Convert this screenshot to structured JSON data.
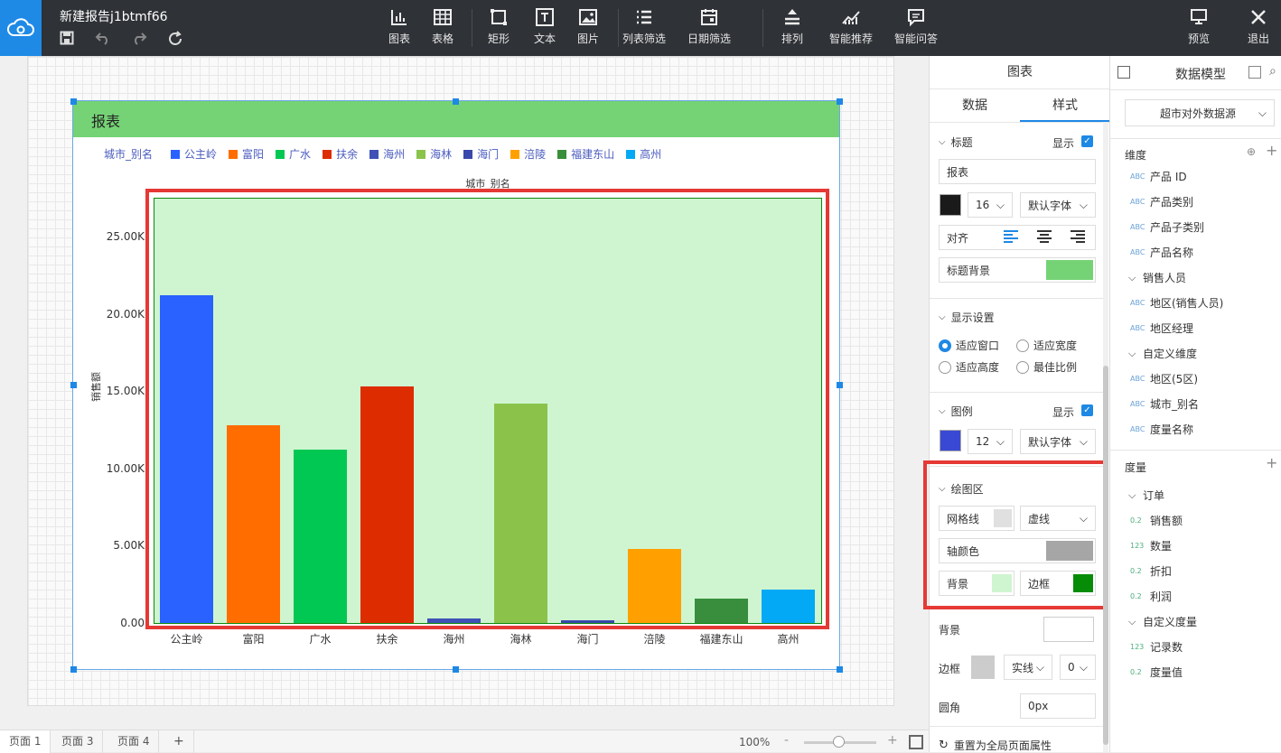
{
  "app": {
    "doc_title": "新建报告j1btmf66",
    "toolbar": [
      {
        "icon": "bar-chart-icon",
        "label": "图表"
      },
      {
        "icon": "table-icon",
        "label": "表格"
      },
      {
        "icon": "rectangle-icon",
        "label": "矩形"
      },
      {
        "icon": "text-icon",
        "label": "文本"
      },
      {
        "icon": "image-icon",
        "label": "图片"
      },
      {
        "icon": "list-filter-icon",
        "label": "列表筛选"
      },
      {
        "icon": "calendar-icon",
        "label": "日期筛选"
      },
      {
        "icon": "arrange-icon",
        "label": "排列"
      },
      {
        "icon": "smart-recommend-icon",
        "label": "智能推荐"
      },
      {
        "icon": "smart-qa-icon",
        "label": "智能问答"
      }
    ],
    "preview_label": "预览",
    "exit_label": "退出"
  },
  "report": {
    "title": "报表",
    "legend_field": "城市_别名",
    "legend_items": [
      {
        "label": "公主岭",
        "color": "#2962ff"
      },
      {
        "label": "富阳",
        "color": "#ff6d00"
      },
      {
        "label": "广水",
        "color": "#00c853"
      },
      {
        "label": "扶余",
        "color": "#dd2c00"
      },
      {
        "label": "海州",
        "color": "#3f51b5"
      },
      {
        "label": "海林",
        "color": "#8bc34a"
      },
      {
        "label": "海门",
        "color": "#3949ab"
      },
      {
        "label": "涪陵",
        "color": "#ffa000"
      },
      {
        "label": "福建东山",
        "color": "#388e3c"
      },
      {
        "label": "高州",
        "color": "#03a9f4"
      }
    ]
  },
  "chart_data": {
    "type": "bar",
    "title": "城市_别名",
    "xlabel": "",
    "ylabel": "销售额",
    "categories": [
      "公主岭",
      "富阳",
      "广水",
      "扶余",
      "海州",
      "海林",
      "海门",
      "涪陵",
      "福建东山",
      "高州"
    ],
    "values": [
      21200,
      12800,
      11200,
      15300,
      320,
      14200,
      180,
      4800,
      1600,
      2150
    ],
    "ylim": [
      0,
      27500
    ],
    "yticks": [
      "0.00",
      "5.00K",
      "10.00K",
      "15.00K",
      "20.00K",
      "25.00K"
    ],
    "ytick_values": [
      0,
      5000,
      10000,
      15000,
      20000,
      25000
    ],
    "colors": [
      "#2962ff",
      "#ff6d00",
      "#00c853",
      "#dd2c00",
      "#3f51b5",
      "#8bc34a",
      "#3949ab",
      "#ffa000",
      "#388e3c",
      "#03a9f4"
    ],
    "plot_background": "#cff5d0",
    "plot_border": "#0a8a0a"
  },
  "pages": {
    "tabs": [
      "页面 1",
      "页面 3",
      "页面 4"
    ],
    "add": "+",
    "zoom": "100%",
    "zoom_minus": "-",
    "zoom_plus": "+"
  },
  "style_panel": {
    "header": "图表",
    "tab_data": "数据",
    "tab_style": "样式",
    "title_section": "标题",
    "show_label": "显示",
    "title_value": "报表",
    "title_font_size": "16",
    "font_default": "默认字体",
    "align_label": "对齐",
    "title_bg_label": "标题背景",
    "display_section": "显示设置",
    "radio_fit_window": "适应窗口",
    "radio_fit_width": "适应宽度",
    "radio_fit_height": "适应高度",
    "radio_best_ratio": "最佳比例",
    "legend_section": "图例",
    "legend_font_size": "12",
    "plot_section": "绘图区",
    "gridline_label": "网格线",
    "gridline_style": "虚线",
    "axis_color_label": "轴颜色",
    "bg_label": "背景",
    "border_label": "边框",
    "background_label": "背景",
    "border_row_label": "边框",
    "border_style": "实线",
    "border_width": "0",
    "radius_label": "圆角",
    "radius_value": "0px",
    "reset_label": "重置为全局页面属性",
    "colors": {
      "title_color": "#1a1a1a",
      "title_bg": "#75d375",
      "legend_color": "#3949d4",
      "gridline": "#e0e0e0",
      "axis": "#a6a6a6",
      "plot_bg": "#cff5d0",
      "plot_border": "#078c07",
      "accent": "#1e88e5"
    }
  },
  "data_model": {
    "header": "数据模型",
    "source": "超市对外数据源",
    "dimension_label": "维度",
    "measure_label": "度量",
    "dimensions": [
      {
        "tag": "ABC",
        "label": "产品 ID",
        "indent": 1
      },
      {
        "tag": "ABC",
        "label": "产品类别",
        "indent": 1
      },
      {
        "tag": "ABC",
        "label": "产品子类别",
        "indent": 1
      },
      {
        "tag": "ABC",
        "label": "产品名称",
        "indent": 1
      },
      {
        "tag": "",
        "label": "销售人员",
        "indent": 0
      },
      {
        "tag": "ABC",
        "label": "地区(销售人员)",
        "indent": 1
      },
      {
        "tag": "ABC",
        "label": "地区经理",
        "indent": 1
      },
      {
        "tag": "",
        "label": "自定义维度",
        "indent": 0
      },
      {
        "tag": "ABC",
        "label": "地区(5区)",
        "indent": 1
      },
      {
        "tag": "ABC",
        "label": "城市_别名",
        "indent": 1
      },
      {
        "tag": "ABC",
        "label": "度量名称",
        "indent": 0.5
      }
    ],
    "measures": [
      {
        "tag": "",
        "label": "订单",
        "indent": 0
      },
      {
        "tag": "0.2",
        "label": "销售额",
        "indent": 1
      },
      {
        "tag": "123",
        "label": "数量",
        "indent": 1
      },
      {
        "tag": "0.2",
        "label": "折扣",
        "indent": 1
      },
      {
        "tag": "0.2",
        "label": "利润",
        "indent": 1
      },
      {
        "tag": "",
        "label": "自定义度量",
        "indent": 0
      },
      {
        "tag": "123",
        "label": "记录数",
        "indent": 1
      },
      {
        "tag": "0.2",
        "label": "度量值",
        "indent": 0.5
      }
    ]
  }
}
